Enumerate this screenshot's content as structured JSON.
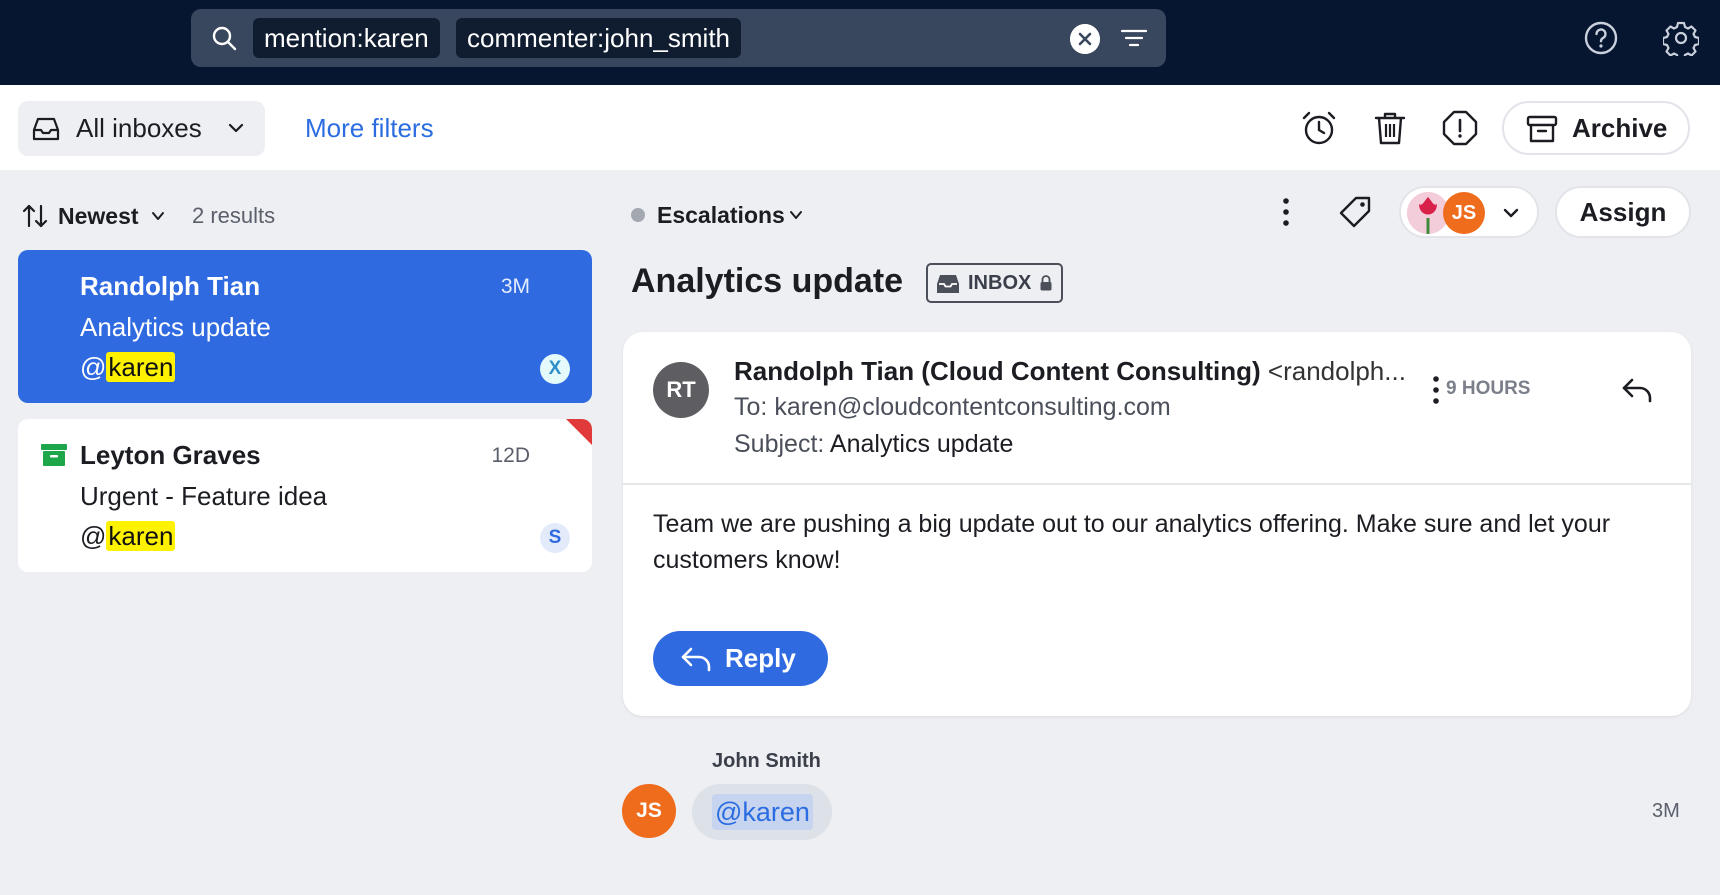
{
  "search": {
    "chips": [
      "mention:karen",
      "commenter:john_smith"
    ]
  },
  "toolbar": {
    "inbox_select": "All inboxes",
    "more_filters": "More filters",
    "archive_label": "Archive"
  },
  "list": {
    "sort_label": "Newest",
    "results_count": "2 results",
    "items": [
      {
        "name": "Randolph Tian",
        "subject": "Analytics update",
        "mention_prefix": "@",
        "mention": "karen",
        "time": "3M",
        "badge": "X"
      },
      {
        "name": "Leyton Graves",
        "subject": "Urgent - Feature idea",
        "mention_prefix": "@",
        "mention": "karen",
        "time": "12D",
        "badge": "S"
      }
    ]
  },
  "conversation": {
    "tag": "Escalations",
    "assignee_initials": "JS",
    "assign_label": "Assign",
    "title": "Analytics update",
    "inbox_badge": "INBOX",
    "message": {
      "avatar_initials": "RT",
      "from_name": "Randolph Tian (Cloud Content Consulting)",
      "from_email": "<randolph...",
      "to_label": "To:",
      "to_value": "karen@cloudcontentconsulting.com",
      "subject_label": "Subject:",
      "subject_value": "Analytics update",
      "time": "9 HOURS",
      "body": "Team we are pushing a big update out to our analytics offering. Make sure and let your customers know!",
      "reply_label": "Reply"
    },
    "comment": {
      "author": "John Smith",
      "avatar_initials": "JS",
      "text": "@karen",
      "time": "3M"
    }
  },
  "colors": {
    "topbar": "#061530",
    "accent_blue": "#2f6ae1",
    "highlight": "#fff200",
    "avatar_orange": "#ee6c1c",
    "archive_green": "#1ea64a",
    "flag_red": "#e03a3a"
  }
}
